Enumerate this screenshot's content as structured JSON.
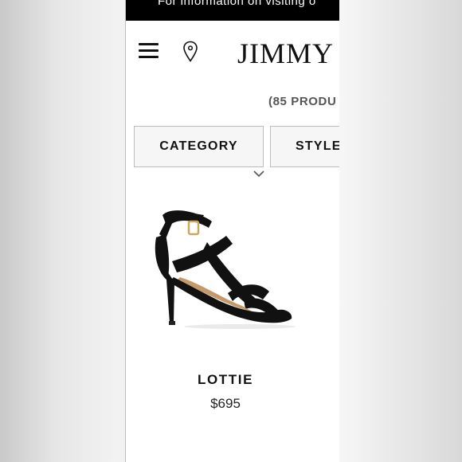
{
  "banner": {
    "text": "For information on visiting o"
  },
  "header": {
    "menu_icon": "hamburger-menu-icon",
    "location_icon": "map-pin-icon",
    "brand": "JIMMY C"
  },
  "results": {
    "count_text": "(85 PRODU"
  },
  "filters": [
    {
      "label": "CATEGORY"
    },
    {
      "label": "STYLE"
    }
  ],
  "product": {
    "name": "LOTTIE",
    "price": "$695",
    "image_icon": "strappy-sandal-image"
  },
  "colors": {
    "banner_bg": "#000000",
    "text": "#111111",
    "filter_bg": "#f6f6f6",
    "filter_border": "#bdbdbd"
  }
}
